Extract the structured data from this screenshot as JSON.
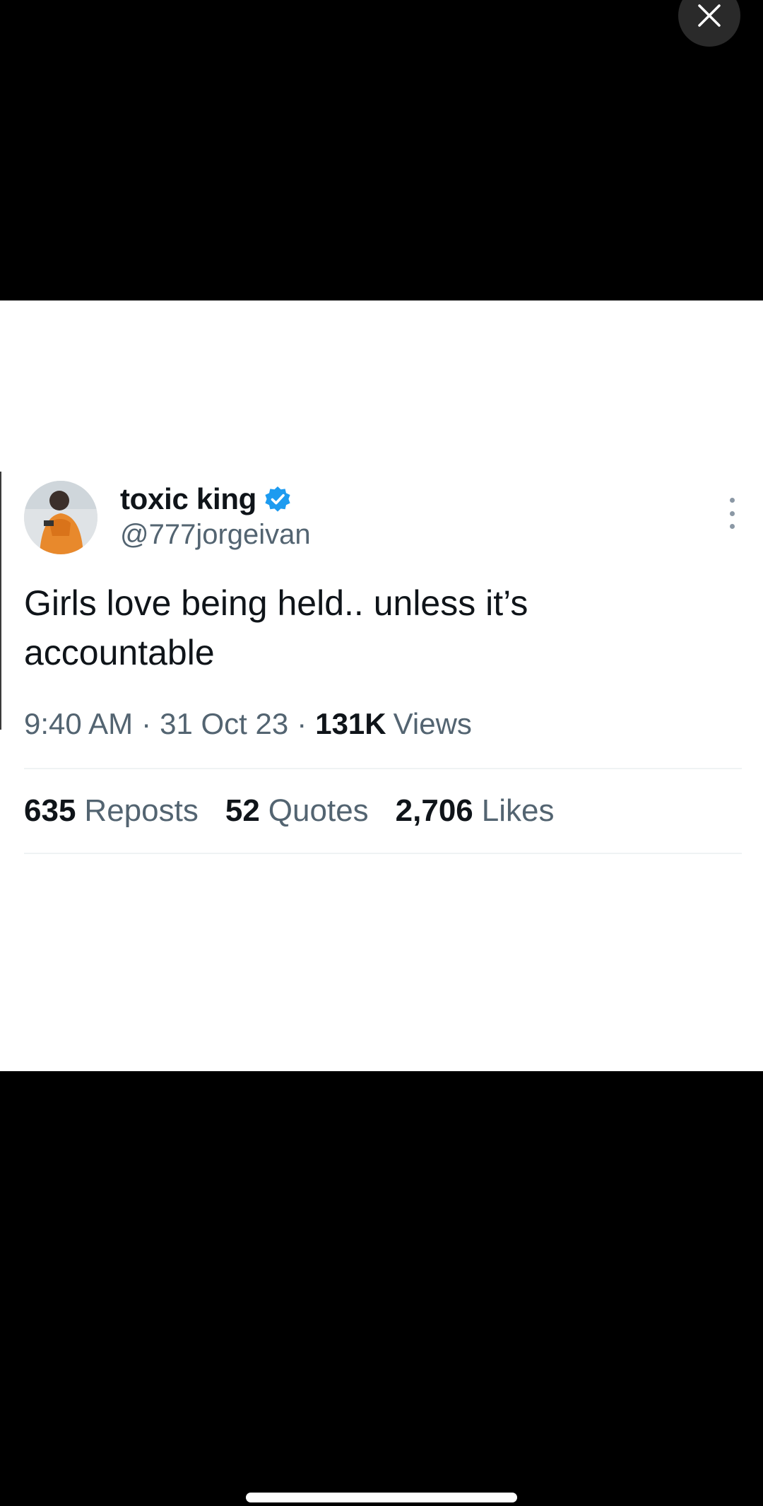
{
  "tweet": {
    "display_name": "toxic king",
    "handle": "@777jorgeivan",
    "text": "Girls love being held.. unless it’s accountable",
    "time": "9:40 AM",
    "date": "31 Oct 23",
    "views_count": "131K",
    "views_label": "Views",
    "separator": "·"
  },
  "stats": [
    {
      "count": "635",
      "label": "Reposts"
    },
    {
      "count": "52",
      "label": "Quotes"
    },
    {
      "count": "2,706",
      "label": "Likes"
    }
  ],
  "icons": {
    "close": "close-icon",
    "verified": "verified-badge-icon",
    "more": "more-vertical-icon"
  },
  "colors": {
    "background": "#000000",
    "card": "#ffffff",
    "primary_text": "#0f1419",
    "secondary_text": "#536471",
    "verified_blue": "#1d9bf0",
    "divider": "#eff3f4"
  }
}
